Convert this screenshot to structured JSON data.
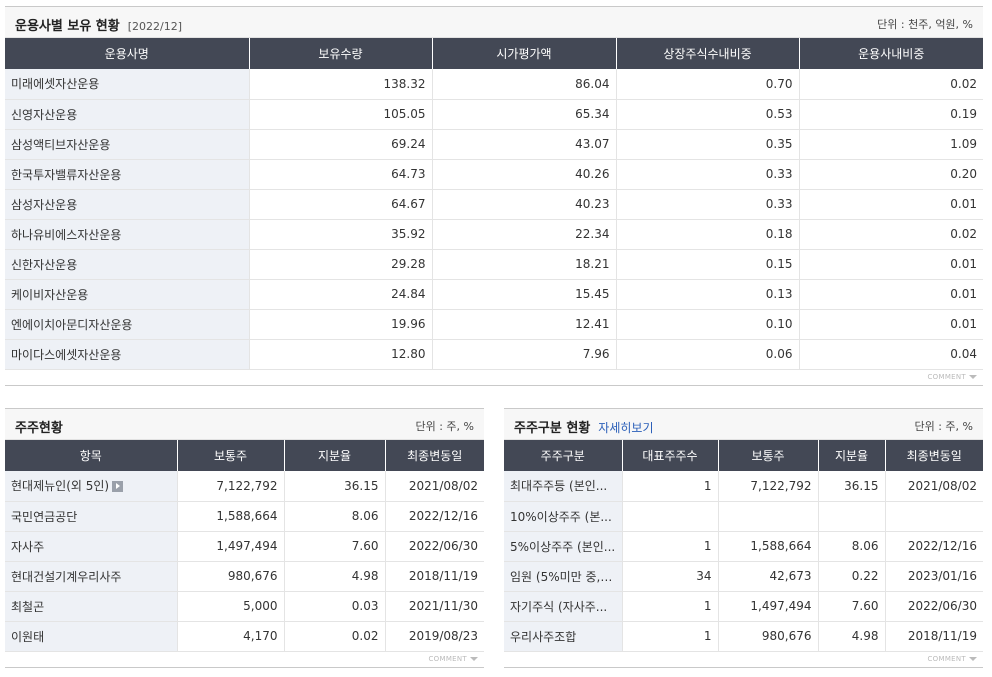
{
  "top": {
    "title": "운용사별 보유 현황",
    "period": "[2022/12]",
    "unit": "단위 : 천주, 억원, %",
    "columns": [
      "운용사명",
      "보유수량",
      "시가평가액",
      "상장주식수내비중",
      "운용사내비중"
    ],
    "rows": [
      [
        "미래에셋자산운용",
        "138.32",
        "86.04",
        "0.70",
        "0.02"
      ],
      [
        "신영자산운용",
        "105.05",
        "65.34",
        "0.53",
        "0.19"
      ],
      [
        "삼성액티브자산운용",
        "69.24",
        "43.07",
        "0.35",
        "1.09"
      ],
      [
        "한국투자밸류자산운용",
        "64.73",
        "40.26",
        "0.33",
        "0.20"
      ],
      [
        "삼성자산운용",
        "64.67",
        "40.23",
        "0.33",
        "0.01"
      ],
      [
        "하나유비에스자산운용",
        "35.92",
        "22.34",
        "0.18",
        "0.02"
      ],
      [
        "신한자산운용",
        "29.28",
        "18.21",
        "0.15",
        "0.01"
      ],
      [
        "케이비자산운용",
        "24.84",
        "15.45",
        "0.13",
        "0.01"
      ],
      [
        "엔에이치아문디자산운용",
        "19.96",
        "12.41",
        "0.10",
        "0.01"
      ],
      [
        "마이다스에셋자산운용",
        "12.80",
        "7.96",
        "0.06",
        "0.04"
      ]
    ],
    "footer": "COMMENT"
  },
  "left": {
    "title": "주주현황",
    "unit": "단위 : 주, %",
    "columns": [
      "항목",
      "보통주",
      "지분율",
      "최종변동일"
    ],
    "rows": [
      [
        "현대제뉴인(외 5인)",
        "7,122,792",
        "36.15",
        "2021/08/02"
      ],
      [
        "국민연금공단",
        "1,588,664",
        "8.06",
        "2022/12/16"
      ],
      [
        "자사주",
        "1,497,494",
        "7.60",
        "2022/06/30"
      ],
      [
        "현대건설기계우리사주",
        "980,676",
        "4.98",
        "2018/11/19"
      ],
      [
        "최철곤",
        "5,000",
        "0.03",
        "2021/11/30"
      ],
      [
        "이원태",
        "4,170",
        "0.02",
        "2019/08/23"
      ]
    ],
    "footer": "COMMENT"
  },
  "right": {
    "title": "주주구분 현황",
    "more": "자세히보기",
    "unit": "단위 : 주, %",
    "columns": [
      "주주구분",
      "대표주주수",
      "보통주",
      "지분율",
      "최종변동일"
    ],
    "rows": [
      [
        "최대주주등 (본인...",
        "1",
        "7,122,792",
        "36.15",
        "2021/08/02"
      ],
      [
        "10%이상주주 (본...",
        "",
        "",
        "",
        ""
      ],
      [
        "5%이상주주 (본인...",
        "1",
        "1,588,664",
        "8.06",
        "2022/12/16"
      ],
      [
        "임원 (5%미만 중, ...",
        "34",
        "42,673",
        "0.22",
        "2023/01/16"
      ],
      [
        "자기주식 (자사주...",
        "1",
        "1,497,494",
        "7.60",
        "2022/06/30"
      ],
      [
        "우리사주조합",
        "1",
        "980,676",
        "4.98",
        "2018/11/19"
      ]
    ],
    "footer": "COMMENT"
  }
}
